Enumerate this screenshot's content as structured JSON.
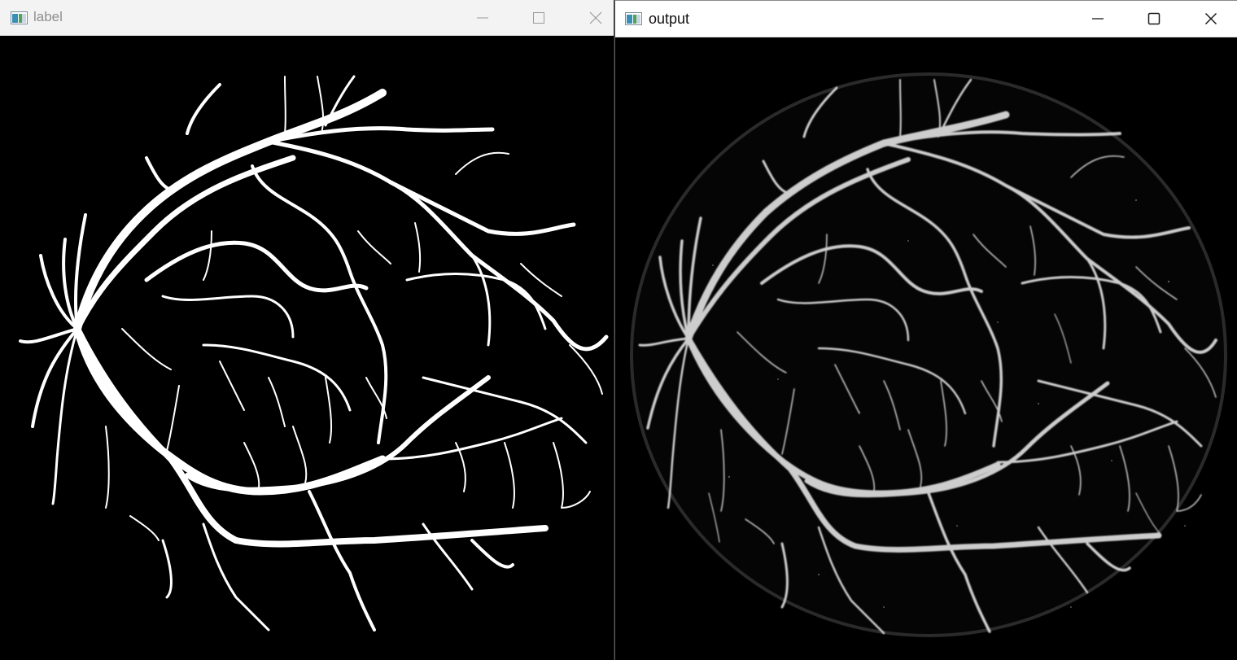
{
  "windows": [
    {
      "title": "label",
      "active": false
    },
    {
      "title": "output",
      "active": true
    }
  ],
  "icons": {
    "app": "image-viewer-icon",
    "minimize": "minimize-icon",
    "maximize": "maximize-icon",
    "close": "close-icon"
  },
  "colors": {
    "inactive_title_text": "#8f8f8f",
    "active_title_text": "#111111",
    "canvas_background": "#000000",
    "vessel_label": "#ffffff",
    "vessel_output": "#d8d8d8"
  }
}
